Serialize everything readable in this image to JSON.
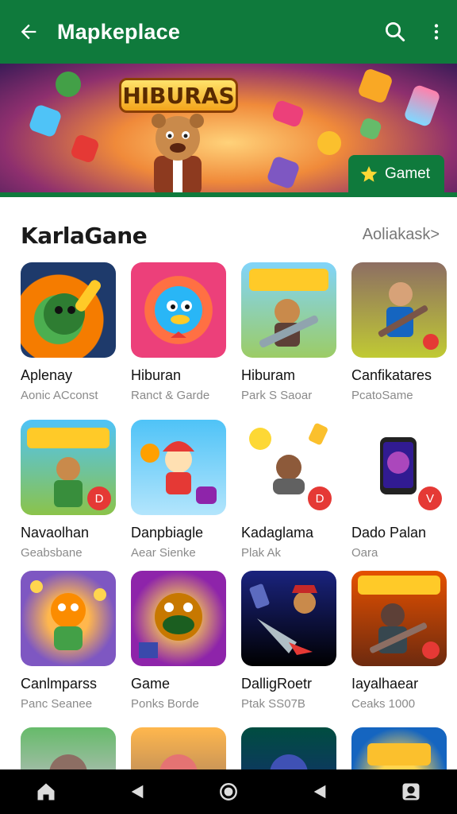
{
  "appbar": {
    "title": "Mapkeplace",
    "back_icon": "arrow-left-icon",
    "search_icon": "search-icon",
    "menu_icon": "more-vert-icon"
  },
  "banner": {
    "logo_text": "HIBURAS",
    "button_label": "Gamet",
    "button_icon": "star-icon"
  },
  "section": {
    "title": "KarlaGane",
    "link": "Aoliakask>"
  },
  "apps": [
    {
      "name": "Aplenay",
      "sub": "Aonic ACconst"
    },
    {
      "name": "Hiburan",
      "sub": "Ranct & Garde"
    },
    {
      "name": "Hiburam",
      "sub": "Park S Saoar"
    },
    {
      "name": "Canfikatares",
      "sub": "PcatoSame"
    },
    {
      "name": "Navaolhan",
      "sub": "Geabsbane"
    },
    {
      "name": "Danpbiagle",
      "sub": "Aear Sienke"
    },
    {
      "name": "Kadaglama",
      "sub": "Plak Ak"
    },
    {
      "name": "Dado Palan",
      "sub": "Oara"
    },
    {
      "name": "Canlmparss",
      "sub": "Panc Seanee"
    },
    {
      "name": "Game",
      "sub": "Ponks Borde"
    },
    {
      "name": "DalligRoetr",
      "sub": "Ptak SS07B"
    },
    {
      "name": "Iayalhaear",
      "sub": "Ceaks 1000"
    }
  ],
  "navbar": {
    "items": [
      "home-icon",
      "back-triangle-icon",
      "home-circle-icon",
      "recents-triangle-icon",
      "profile-icon"
    ]
  },
  "colors": {
    "primary": "#0f7a3c",
    "accent": "#e53935"
  }
}
